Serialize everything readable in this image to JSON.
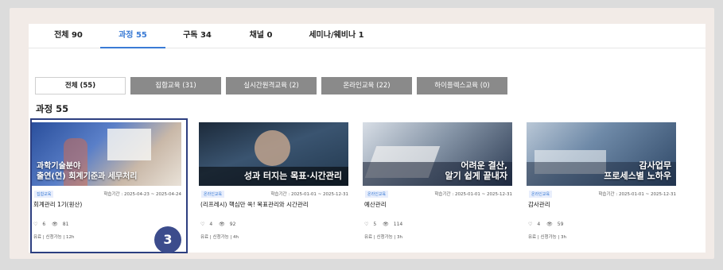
{
  "tabs": [
    {
      "label": "전체 90"
    },
    {
      "label": "과정 55"
    },
    {
      "label": "구독 34"
    },
    {
      "label": "채널 0"
    },
    {
      "label": "세미나/웨비나 1"
    }
  ],
  "filters": [
    {
      "label": "전체 (55)"
    },
    {
      "label": "집합교육 (31)"
    },
    {
      "label": "실시간원격교육 (2)"
    },
    {
      "label": "온라인교육 (22)"
    },
    {
      "label": "하이플렉스교육 (0)"
    }
  ],
  "section_title": "과정 55",
  "cards": [
    {
      "thumb_line1": "과학기술분야",
      "thumb_line2": "출연(연) 회계기준과 세무처리",
      "badge": "집합교육",
      "period": "학습기간 : 2025-04-23 ~ 2025-04-24",
      "title": "회계관리 1기(원산)",
      "likes": "6",
      "views": "81",
      "meta": "유료 | 신청가능 | 12h"
    },
    {
      "thumb_line1": "성과 터지는 목표·시간관리",
      "thumb_line2": "",
      "badge": "온라인교육",
      "period": "학습기간 : 2025-01-01 ~ 2025-12-31",
      "title": "(리프레시) 핵심만 쏙! 목표관리와 시간관리",
      "likes": "4",
      "views": "92",
      "meta": "유료 | 신청가능 | 4h"
    },
    {
      "thumb_line1": "어려운 결산,",
      "thumb_line2": "알기 쉽게 끝내자",
      "badge": "온라인교육",
      "period": "학습기간 : 2025-01-01 ~ 2025-12-31",
      "title": "예산관리",
      "likes": "5",
      "views": "114",
      "meta": "유료 | 신청가능 | 3h"
    },
    {
      "thumb_line1": "감사업무",
      "thumb_line2": "프로세스별 노하우",
      "badge": "온라인교육",
      "period": "학습기간 : 2025-01-01 ~ 2025-12-31",
      "title": "감사관리",
      "likes": "4",
      "views": "59",
      "meta": "유료 | 신청가능 | 3h"
    }
  ],
  "marker": "3",
  "colors": {
    "accent": "#3a7bd5",
    "highlight_border": "#2d3f80",
    "marker_bg": "#3c4c8c",
    "filter_bg": "#8a8a8a"
  }
}
